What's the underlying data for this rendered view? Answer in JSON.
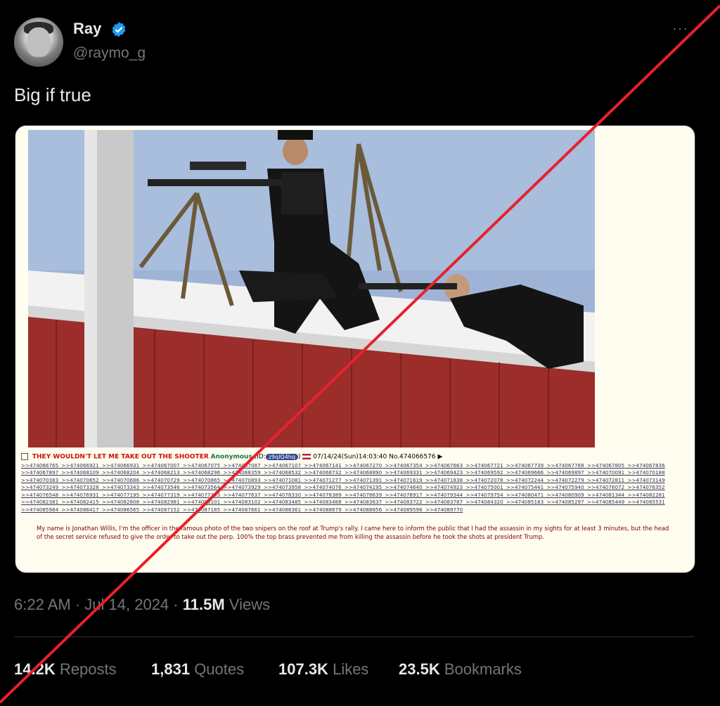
{
  "author": {
    "name": "Ray",
    "handle": "@raymo_g",
    "verified": true,
    "avatar": "avatar-photo"
  },
  "more_icon": "more-options-icon",
  "tweet": {
    "text": "Big if true"
  },
  "media": {
    "photo_icon": "rooftop-snipers-photo",
    "post": {
      "subject": "THEY WOULDN'T LET ME TAKE OUT THE SHOOTER",
      "name": "Anonymous",
      "id_prefix": "(ID:",
      "id": "z9qlQ4hq",
      "id_suffix": ")",
      "datetime": "07/14/24(Sun)14:03:40",
      "number": "No.474066576",
      "replies": [
        ">>474066765",
        ">>474066921",
        ">>474066931",
        ">>474067007",
        ">>474067075",
        ">>474067087",
        ">>474067107",
        ">>474067141",
        ">>474067270",
        ">>474067354",
        ">>474067663",
        ">>474067721",
        ">>474067739",
        ">>474067788",
        ">>474067805",
        ">>474067836",
        ">>474067897",
        ">>474068109",
        ">>474068204",
        ">>474068213",
        ">>474068296",
        ">>474068359",
        ">>474068532",
        ">>474068732",
        ">>474068890",
        ">>474069331",
        ">>474069423",
        ">>474069592",
        ">>474069666",
        ">>474069897",
        ">>474070091",
        ">>474070188",
        ">>474070383",
        ">>474070652",
        ">>474070686",
        ">>474070729",
        ">>474070865",
        ">>474070893",
        ">>474071081",
        ">>474071277",
        ">>474071391",
        ">>474071619",
        ">>474071838",
        ">>474072078",
        ">>474072244",
        ">>474072279",
        ">>474072811",
        ">>474073149",
        ">>474073249",
        ">>474073328",
        ">>474073343",
        ">>474073546",
        ">>474073564",
        ">>474073929",
        ">>474073958",
        ">>474074076",
        ">>474074195",
        ">>474074640",
        ">>474074923",
        ">>474075001",
        ">>474075441",
        ">>474075940",
        ">>474076072",
        ">>474076352",
        ">>474076548",
        ">>474076931",
        ">>474077195",
        ">>474077319",
        ">>474077383",
        ">>474077637",
        ">>474078330",
        ">>474078389",
        ">>474078639",
        ">>474078917",
        ">>474079344",
        ">>474079754",
        ">>474080471",
        ">>474080909",
        ">>474081344",
        ">>474082281",
        ">>474082381",
        ">>474082415",
        ">>474082808",
        ">>474082981",
        ">>474083101",
        ">>474083102",
        ">>474083485",
        ">>474083488",
        ">>474083637",
        ">>474083722",
        ">>474083787",
        ">>474084320",
        ">>474085183",
        ">>474085297",
        ">>474085449",
        ">>474085531",
        ">>474085984",
        ">>474086417",
        ">>474086565",
        ">>474087152",
        ">>474087185",
        ">>474087661",
        ">>474088361",
        ">>474088679",
        ">>474088856",
        ">>474089596",
        ">>474089770"
      ],
      "body": "My name is Jonathan Willis, I'm the officer in the famous photo of the two snipers on the roof at Trump's rally. I came here to inform the public that I had the assassin in my sights for at least 3 minutes, but the head of the secret service refused to give the order to take out the perp. 100% the top brass prevented me from killing the assassin before he took the shots at president Trump."
    }
  },
  "meta": {
    "time": "6:22 AM",
    "separator": "·",
    "date": "Jul 14, 2024",
    "views_count": "11.5M",
    "views_label": "Views"
  },
  "stats": {
    "reposts_count": "14.2K",
    "reposts_label": "Reposts",
    "quotes_count": "1,831",
    "quotes_label": "Quotes",
    "likes_count": "107.3K",
    "likes_label": "Likes",
    "bookmarks_count": "23.5K",
    "bookmarks_label": "Bookmarks"
  },
  "colors": {
    "background": "#000000",
    "text": "#e7e9ea",
    "muted": "#71767b",
    "verified": "#1d9bf0",
    "overlay_line": "#e8202a"
  }
}
